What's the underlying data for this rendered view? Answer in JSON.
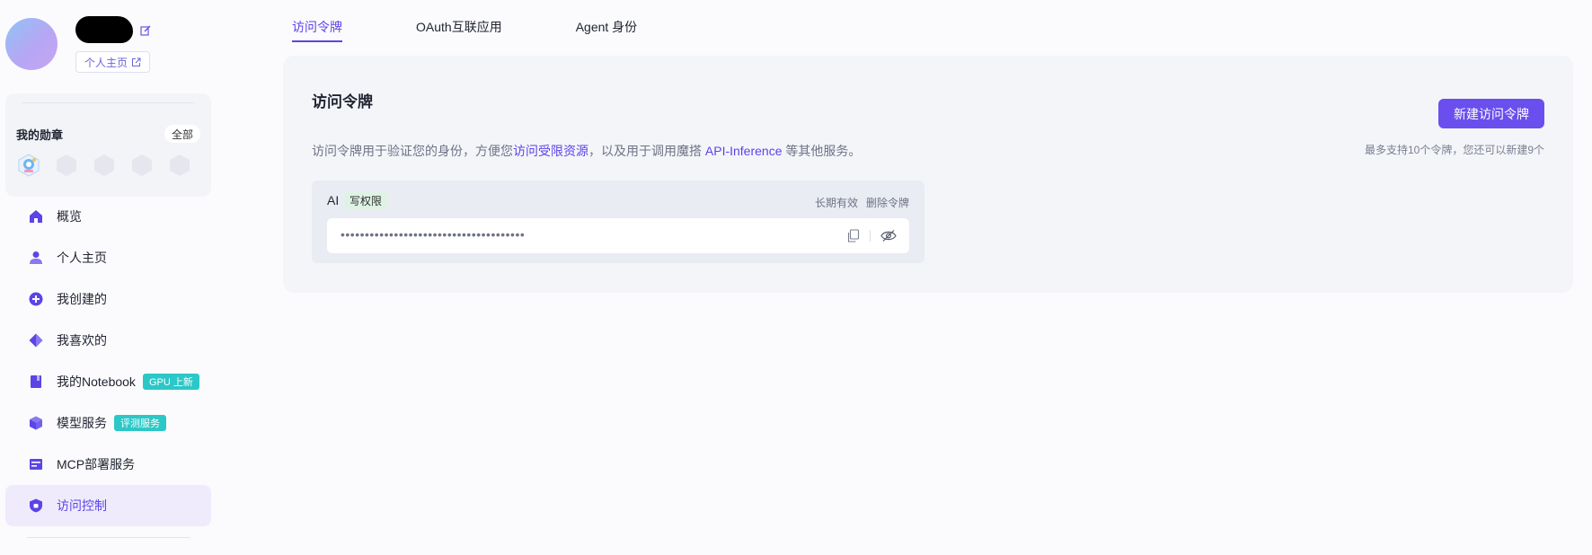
{
  "profile": {
    "profile_link_label": "个人主页"
  },
  "badges": {
    "title": "我的勋章",
    "all_label": "全部",
    "icons": [
      "badge-earned-icon",
      "badge-locked-icon",
      "badge-locked-icon",
      "badge-locked-icon",
      "badge-locked-icon"
    ]
  },
  "nav": {
    "items": [
      {
        "label": "概览",
        "icon": "home-icon"
      },
      {
        "label": "个人主页",
        "icon": "user-icon"
      },
      {
        "label": "我创建的",
        "icon": "plus-circle-icon"
      },
      {
        "label": "我喜欢的",
        "icon": "diamond-icon"
      },
      {
        "label": "我的Notebook",
        "icon": "notebook-icon",
        "tag": "GPU 上新"
      },
      {
        "label": "模型服务",
        "icon": "cube-icon",
        "tag": "评测服务"
      },
      {
        "label": "MCP部署服务",
        "icon": "server-icon"
      },
      {
        "label": "访问控制",
        "icon": "shield-icon",
        "active": true
      }
    ]
  },
  "tabs": [
    {
      "label": "访问令牌",
      "active": true
    },
    {
      "label": "OAuth互联应用",
      "active": false
    },
    {
      "label": "Agent 身份",
      "active": false
    }
  ],
  "panel": {
    "title": "访问令牌",
    "desc_part1": "访问令牌用于验证您的身份，方便您",
    "desc_link1": "访问受限资源",
    "desc_part2": "，以及用于调用魔搭 ",
    "desc_link2": "API-Inference",
    "desc_part3": " 等其他服务。",
    "new_button_label": "新建访问令牌",
    "limit_note": "最多支持10个令牌，您还可以新建9个"
  },
  "token": {
    "name": "AI",
    "permission": "写权限",
    "validity": "长期有效",
    "delete_label": "删除令牌",
    "masked_value": "••••••••••••••••••••••••••••••••••••••"
  },
  "colors": {
    "accent": "#5b44e8",
    "button": "#6a4fee",
    "tag": "#2cc7c7",
    "active_nav_bg": "#efebfd"
  }
}
